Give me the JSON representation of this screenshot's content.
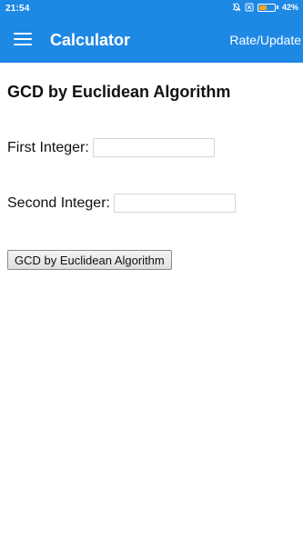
{
  "status_bar": {
    "time": "21:54",
    "battery_percent": "42%",
    "battery_level": 0.42,
    "icons": [
      "mute-icon",
      "notification-icon"
    ]
  },
  "app_bar": {
    "title": "Calculator",
    "action_label": "Rate/Update",
    "background_color": "#1e88e5"
  },
  "main": {
    "title": "GCD by Euclidean Algorithm",
    "fields": [
      {
        "label": "First Integer:",
        "value": "",
        "placeholder": ""
      },
      {
        "label": "Second Integer:",
        "value": "",
        "placeholder": ""
      }
    ],
    "button_label": "GCD by Euclidean Algorithm"
  }
}
